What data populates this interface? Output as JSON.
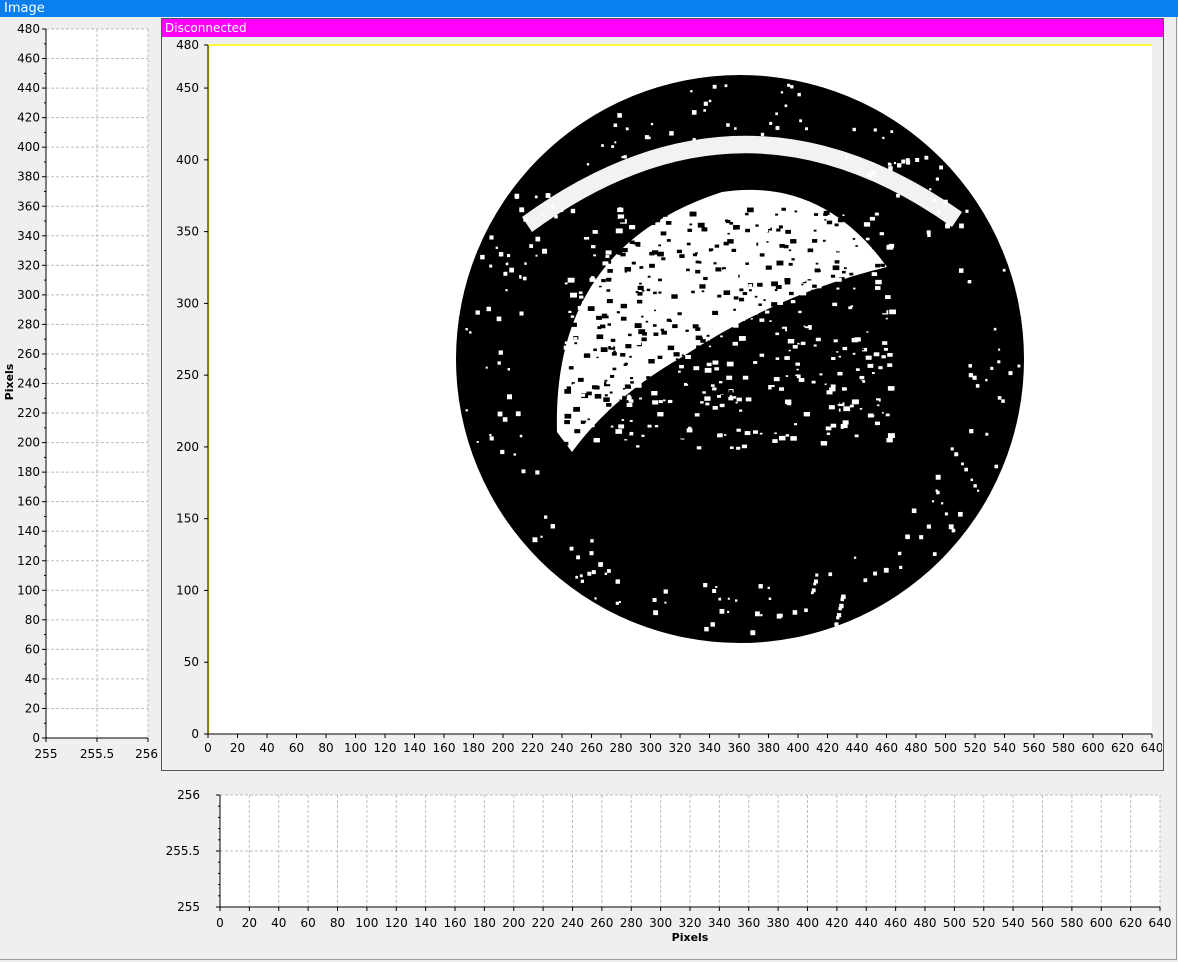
{
  "window": {
    "title": "Image"
  },
  "status": {
    "text": "Disconnected",
    "color": "#ff00ff"
  },
  "main_plot": {
    "x_ticks": [
      0,
      20,
      40,
      60,
      80,
      100,
      120,
      140,
      160,
      180,
      200,
      220,
      240,
      260,
      280,
      300,
      320,
      340,
      360,
      380,
      400,
      420,
      440,
      460,
      480,
      500,
      520,
      540,
      560,
      580,
      600,
      620,
      640
    ],
    "y_ticks": [
      0,
      50,
      100,
      150,
      200,
      250,
      300,
      350,
      400,
      450,
      480
    ],
    "xlim": [
      0,
      640
    ],
    "ylim": [
      0,
      480
    ],
    "image_content": "binarized circular disc (black) with white crescent highlight and speckle",
    "frame_color": "#ffff00"
  },
  "left_profile": {
    "y_label": "Pixels",
    "y_ticks": [
      0,
      20,
      40,
      60,
      80,
      100,
      120,
      140,
      160,
      180,
      200,
      220,
      240,
      260,
      280,
      300,
      320,
      340,
      360,
      380,
      400,
      420,
      440,
      460,
      480
    ],
    "x_ticks": [
      "255",
      "255.5",
      "256"
    ],
    "xlim": [
      255,
      256
    ],
    "ylim": [
      0,
      480
    ]
  },
  "bottom_profile": {
    "x_label": "Pixels",
    "x_ticks": [
      0,
      20,
      40,
      60,
      80,
      100,
      120,
      140,
      160,
      180,
      200,
      220,
      240,
      260,
      280,
      300,
      320,
      340,
      360,
      380,
      400,
      420,
      440,
      460,
      480,
      500,
      520,
      540,
      560,
      580,
      600,
      620,
      640
    ],
    "y_ticks": [
      "255",
      "255.5",
      "256"
    ],
    "xlim": [
      0,
      640
    ],
    "ylim": [
      255,
      256
    ]
  }
}
